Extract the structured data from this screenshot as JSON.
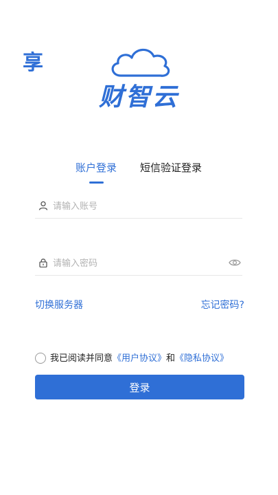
{
  "logo": {
    "glyph": "享",
    "brand": "财智云"
  },
  "tabs": [
    {
      "label": "账户登录",
      "active": true
    },
    {
      "label": "短信验证登录",
      "active": false
    }
  ],
  "account_field": {
    "placeholder": "请输入账号",
    "value": "",
    "icon": "user-icon"
  },
  "password_field": {
    "placeholder": "请输入密码",
    "value": "",
    "icon": "lock-icon",
    "toggle_icon": "eye-icon"
  },
  "links": {
    "switch_server": "切换服务器",
    "forgot_password": "忘记密码?"
  },
  "agreement": {
    "checked": false,
    "prefix": "我已阅读并同意",
    "user_agreement": "《用户协议》",
    "conjunction": "和",
    "privacy_agreement": "《隐私协议》"
  },
  "login_button": "登录",
  "colors": {
    "accent": "#2f6fd6",
    "placeholder": "#b3b3b3",
    "divider": "#e6e6e6"
  }
}
